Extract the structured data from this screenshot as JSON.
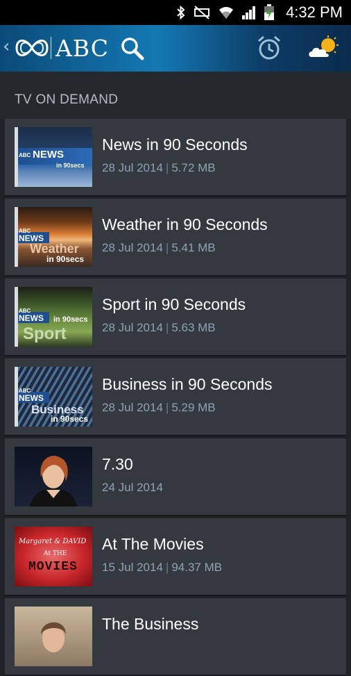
{
  "status_bar": {
    "time": "4:32 PM",
    "icons": [
      "bluetooth-icon",
      "mute-icon",
      "wifi-icon",
      "signal-icon",
      "battery-charging-icon"
    ]
  },
  "header": {
    "brand": "ABC",
    "back_glyph": "‹"
  },
  "section": {
    "label": "TV ON DEMAND"
  },
  "items": [
    {
      "title": "News in 90 Seconds",
      "date": "28 Jul 2014",
      "size": "5.72 MB",
      "thumb_text": "NEWS",
      "thumb_sub": "in 90secs"
    },
    {
      "title": "Weather in 90 Seconds",
      "date": "28 Jul 2014",
      "size": "5.41 MB",
      "thumb_text": "Weather",
      "thumb_sub": "in 90secs"
    },
    {
      "title": "Sport in 90 Seconds",
      "date": "28 Jul 2014",
      "size": "5.63 MB",
      "thumb_text": "Sport",
      "thumb_sub": "in 90secs"
    },
    {
      "title": "Business in 90 Seconds",
      "date": "28 Jul 2014",
      "size": "5.29 MB",
      "thumb_text": "Business",
      "thumb_sub": "in 90secs"
    },
    {
      "title": "7.30",
      "date": "24 Jul 2014",
      "size": ""
    },
    {
      "title": "At The Movies",
      "date": "15 Jul 2014",
      "size": "94.37 MB",
      "thumb_text": "Margaret & DAVID",
      "thumb_mid": "At THE",
      "thumb_sub": "MOVIES"
    },
    {
      "title": "The Business",
      "date": "",
      "size": ""
    }
  ],
  "thumb_abc": "ABC",
  "thumb_news": "NEWS",
  "colors": {
    "appbar": "#1479b3",
    "row_bg": "#343940",
    "meta": "#8fa3b5"
  }
}
